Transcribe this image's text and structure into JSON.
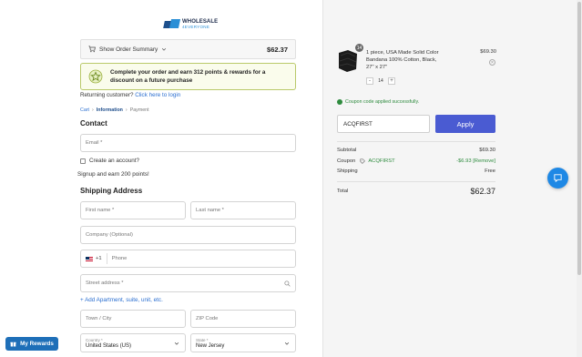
{
  "brand": {
    "name_line1": "WHOLESALE",
    "name_line2": "4EVERYONE"
  },
  "summary": {
    "label": "Show Order Summary",
    "total": "$62.37"
  },
  "points_banner": {
    "text": "Complete your order and earn 312 points & rewards for a discount on a future purchase"
  },
  "returning": {
    "prefix": "Returning customer?",
    "link": "Click here to login"
  },
  "breadcrumb": {
    "cart": "Cart",
    "information": "Information",
    "payment": "Payment"
  },
  "contact": {
    "heading": "Contact",
    "email_placeholder": "Email *",
    "create_account": "Create an account?",
    "signup_points": "Signup and earn 200 points!"
  },
  "shipping": {
    "heading": "Shipping Address",
    "first_name": "First name *",
    "last_name": "Last name *",
    "company": "Company (Optional)",
    "phone_code": "+1",
    "phone": "Phone",
    "street": "Street address *",
    "add_apartment": "+ Add Apartment, suite, unit, etc.",
    "town": "Town / City",
    "zip": "ZIP Code",
    "country_label": "Country *",
    "country_value": "United States (US)",
    "state_label": "State *",
    "state_value": "New Jersey"
  },
  "rewards_button": "My Rewards",
  "cart": {
    "item": {
      "quantity_badge": "14",
      "title": "1 piece, USA Made Solid Color Bandana 100% Cotton, Black, 27\" x 27\"",
      "price": "$69.30",
      "qty": "14",
      "minus": "-",
      "plus": "+"
    },
    "coupon_message": "Coupon code applied successfully.",
    "coupon_input_value": "ACQFIRST",
    "apply_label": "Apply",
    "subtotal_label": "Subtotal",
    "subtotal_value": "$69.30",
    "coupon_label": "Coupon",
    "coupon_code": "ACQFIRST",
    "coupon_discount": "-$6.93 [Remove]",
    "shipping_label": "Shipping",
    "shipping_value": "Free",
    "total_label": "Total",
    "total_value": "$62.37"
  },
  "colors": {
    "accent": "#4a5bd2",
    "link": "#2b6fd0",
    "success": "#2e8b3e",
    "rewards": "#1e6fb8",
    "chat": "#1e88e5"
  },
  "icons": [
    "cart-icon",
    "chevron-down-icon",
    "star-badge-icon",
    "search-icon",
    "gift-icon",
    "check-circle-icon",
    "tag-icon",
    "remove-icon",
    "chat-icon"
  ]
}
